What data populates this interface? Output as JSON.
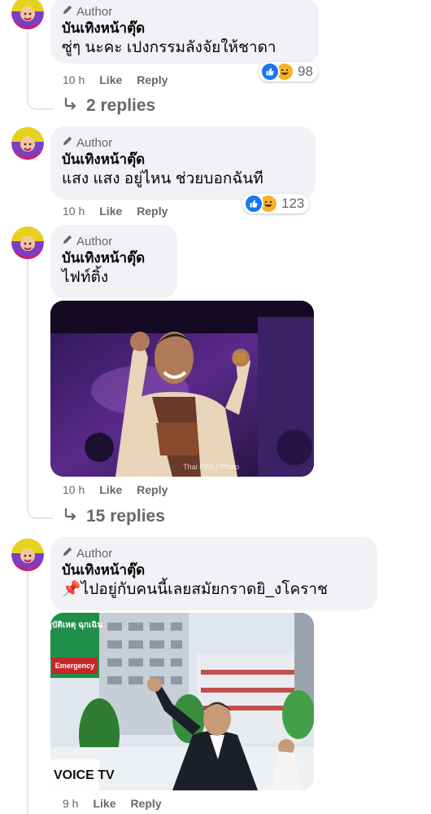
{
  "comments": [
    {
      "badge": "Author",
      "author": "บันเทิงหน้าตุ๊ด",
      "text": "ซู่ๆ นะคะ เปงกรรมลังจัยให้ชาดา",
      "time": "10 h",
      "like": "Like",
      "reply": "Reply",
      "reaction_count": "98",
      "replies": "2 replies"
    },
    {
      "badge": "Author",
      "author": "บันเทิงหน้าตุ๊ด",
      "text": "แสง แสง อยู่ไหน ช่วยบอกฉันที",
      "time": "10 h",
      "like": "Like",
      "reply": "Reply",
      "reaction_count": "123"
    },
    {
      "badge": "Author",
      "author": "บันเทิงหน้าตุ๊ด",
      "text": "ไฟท์ติ้ง",
      "time": "10 h",
      "like": "Like",
      "reply": "Reply",
      "photo_watermark": "Thai PBS | Photo",
      "replies": "15 replies"
    },
    {
      "badge": "Author",
      "author": "บันเทิงหน้าตุ๊ด",
      "text": "ไปอยู่กับคนนี้เลยสมัยกราดยิ_งโคราช",
      "pin_icon": "📌",
      "time": "9 h",
      "like": "Like",
      "reply": "Reply",
      "photo_sign_th": "อุบัติเหตุ ฉุกเฉิน",
      "photo_sign_en": "Emergency",
      "photo_watermark": "VOICE TV"
    }
  ],
  "colors": {
    "bubble": "#f0f2f5",
    "secondary_text": "#65676b",
    "like_blue": "#1877f2",
    "haha_yellow": "#f7b125"
  }
}
